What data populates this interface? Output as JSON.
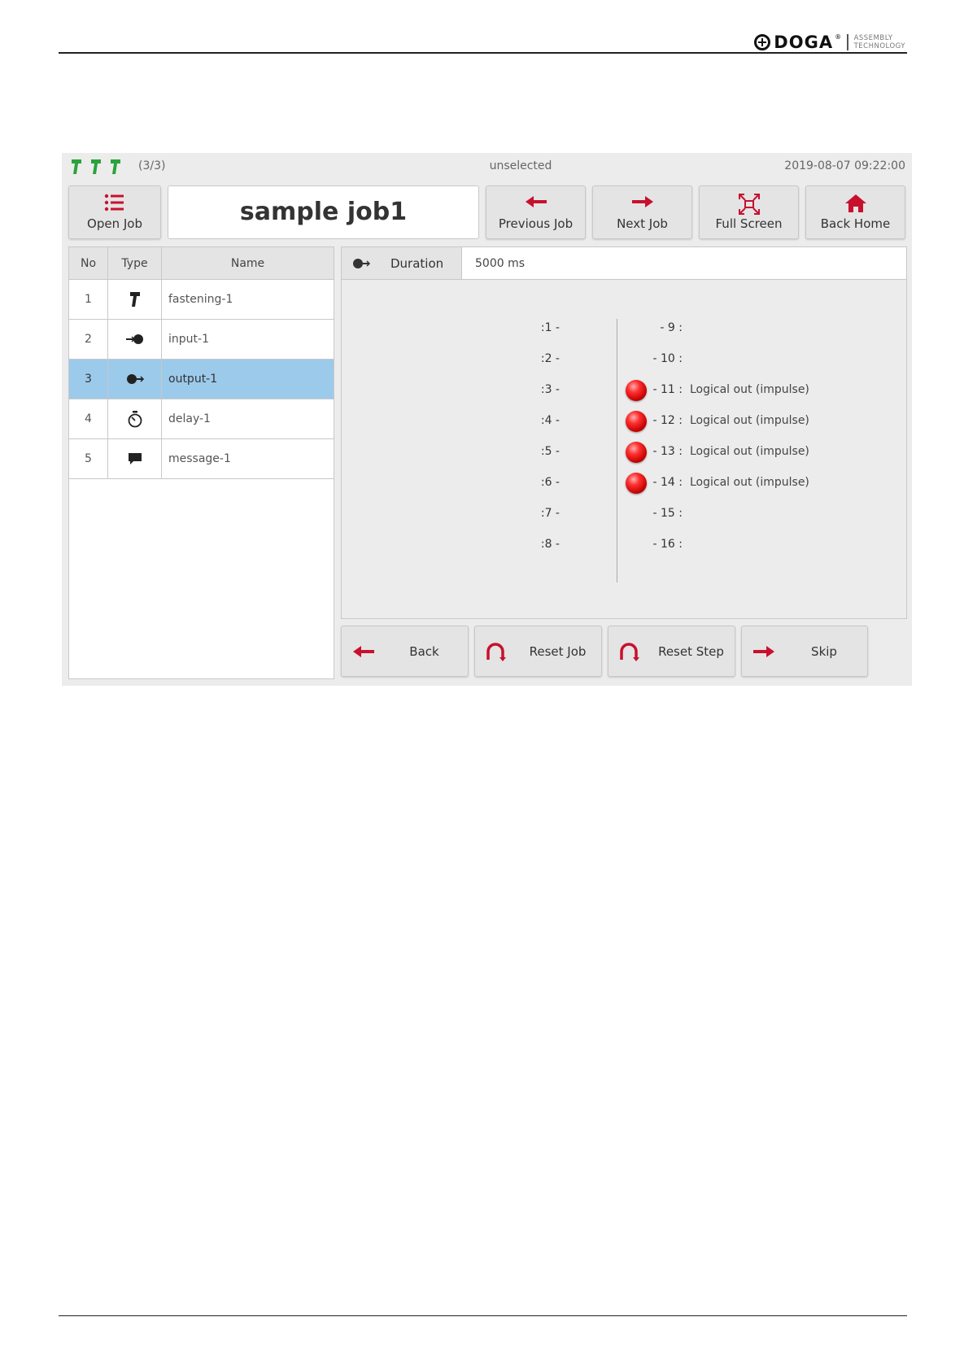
{
  "doc": {
    "logo_word": "DOGA",
    "logo_reg": "®",
    "logo_sub1": "ASSEMBLY",
    "logo_sub2": "TECHNOLOGY"
  },
  "status": {
    "tool_count": "(3/3)",
    "selection": "unselected",
    "datetime": "2019-08-07 09:22:00"
  },
  "toolbar": {
    "open_job": "Open Job",
    "job_name": "sample job1",
    "previous_job": "Previous Job",
    "next_job": "Next Job",
    "full_screen": "Full Screen",
    "back_home": "Back Home"
  },
  "steps": {
    "headers": {
      "no": "No",
      "type": "Type",
      "name": "Name"
    },
    "rows": [
      {
        "no": "1",
        "type_icon": "fastening-icon",
        "name": "fastening-1"
      },
      {
        "no": "2",
        "type_icon": "input-icon",
        "name": "input-1"
      },
      {
        "no": "3",
        "type_icon": "output-icon",
        "name": "output-1"
      },
      {
        "no": "4",
        "type_icon": "delay-icon",
        "name": "delay-1"
      },
      {
        "no": "5",
        "type_icon": "message-icon",
        "name": "message-1"
      }
    ]
  },
  "detail": {
    "duration_label": "Duration",
    "duration_value": "5000 ms",
    "left_ports": [
      ":1 -",
      ":2 -",
      ":3 -",
      ":4 -",
      ":5 -",
      ":6 -",
      ":7 -",
      ":8 -"
    ],
    "right_ports": [
      {
        "label": "- 9 :",
        "active": false,
        "desc": ""
      },
      {
        "label": "- 10 :",
        "active": false,
        "desc": ""
      },
      {
        "label": "- 11 :",
        "active": true,
        "desc": "Logical out (impulse)"
      },
      {
        "label": "- 12 :",
        "active": true,
        "desc": "Logical out (impulse)"
      },
      {
        "label": "- 13 :",
        "active": true,
        "desc": "Logical out (impulse)"
      },
      {
        "label": "- 14 :",
        "active": true,
        "desc": "Logical out (impulse)"
      },
      {
        "label": "- 15 :",
        "active": false,
        "desc": ""
      },
      {
        "label": "- 16 :",
        "active": false,
        "desc": ""
      }
    ]
  },
  "actions": {
    "back": "Back",
    "reset_job": "Reset Job",
    "reset_step": "Reset Step",
    "skip": "Skip"
  },
  "colors": {
    "tool_green": "#2aa33a",
    "accent_red": "#c8102e",
    "selected_row": "#9ccaeb"
  }
}
